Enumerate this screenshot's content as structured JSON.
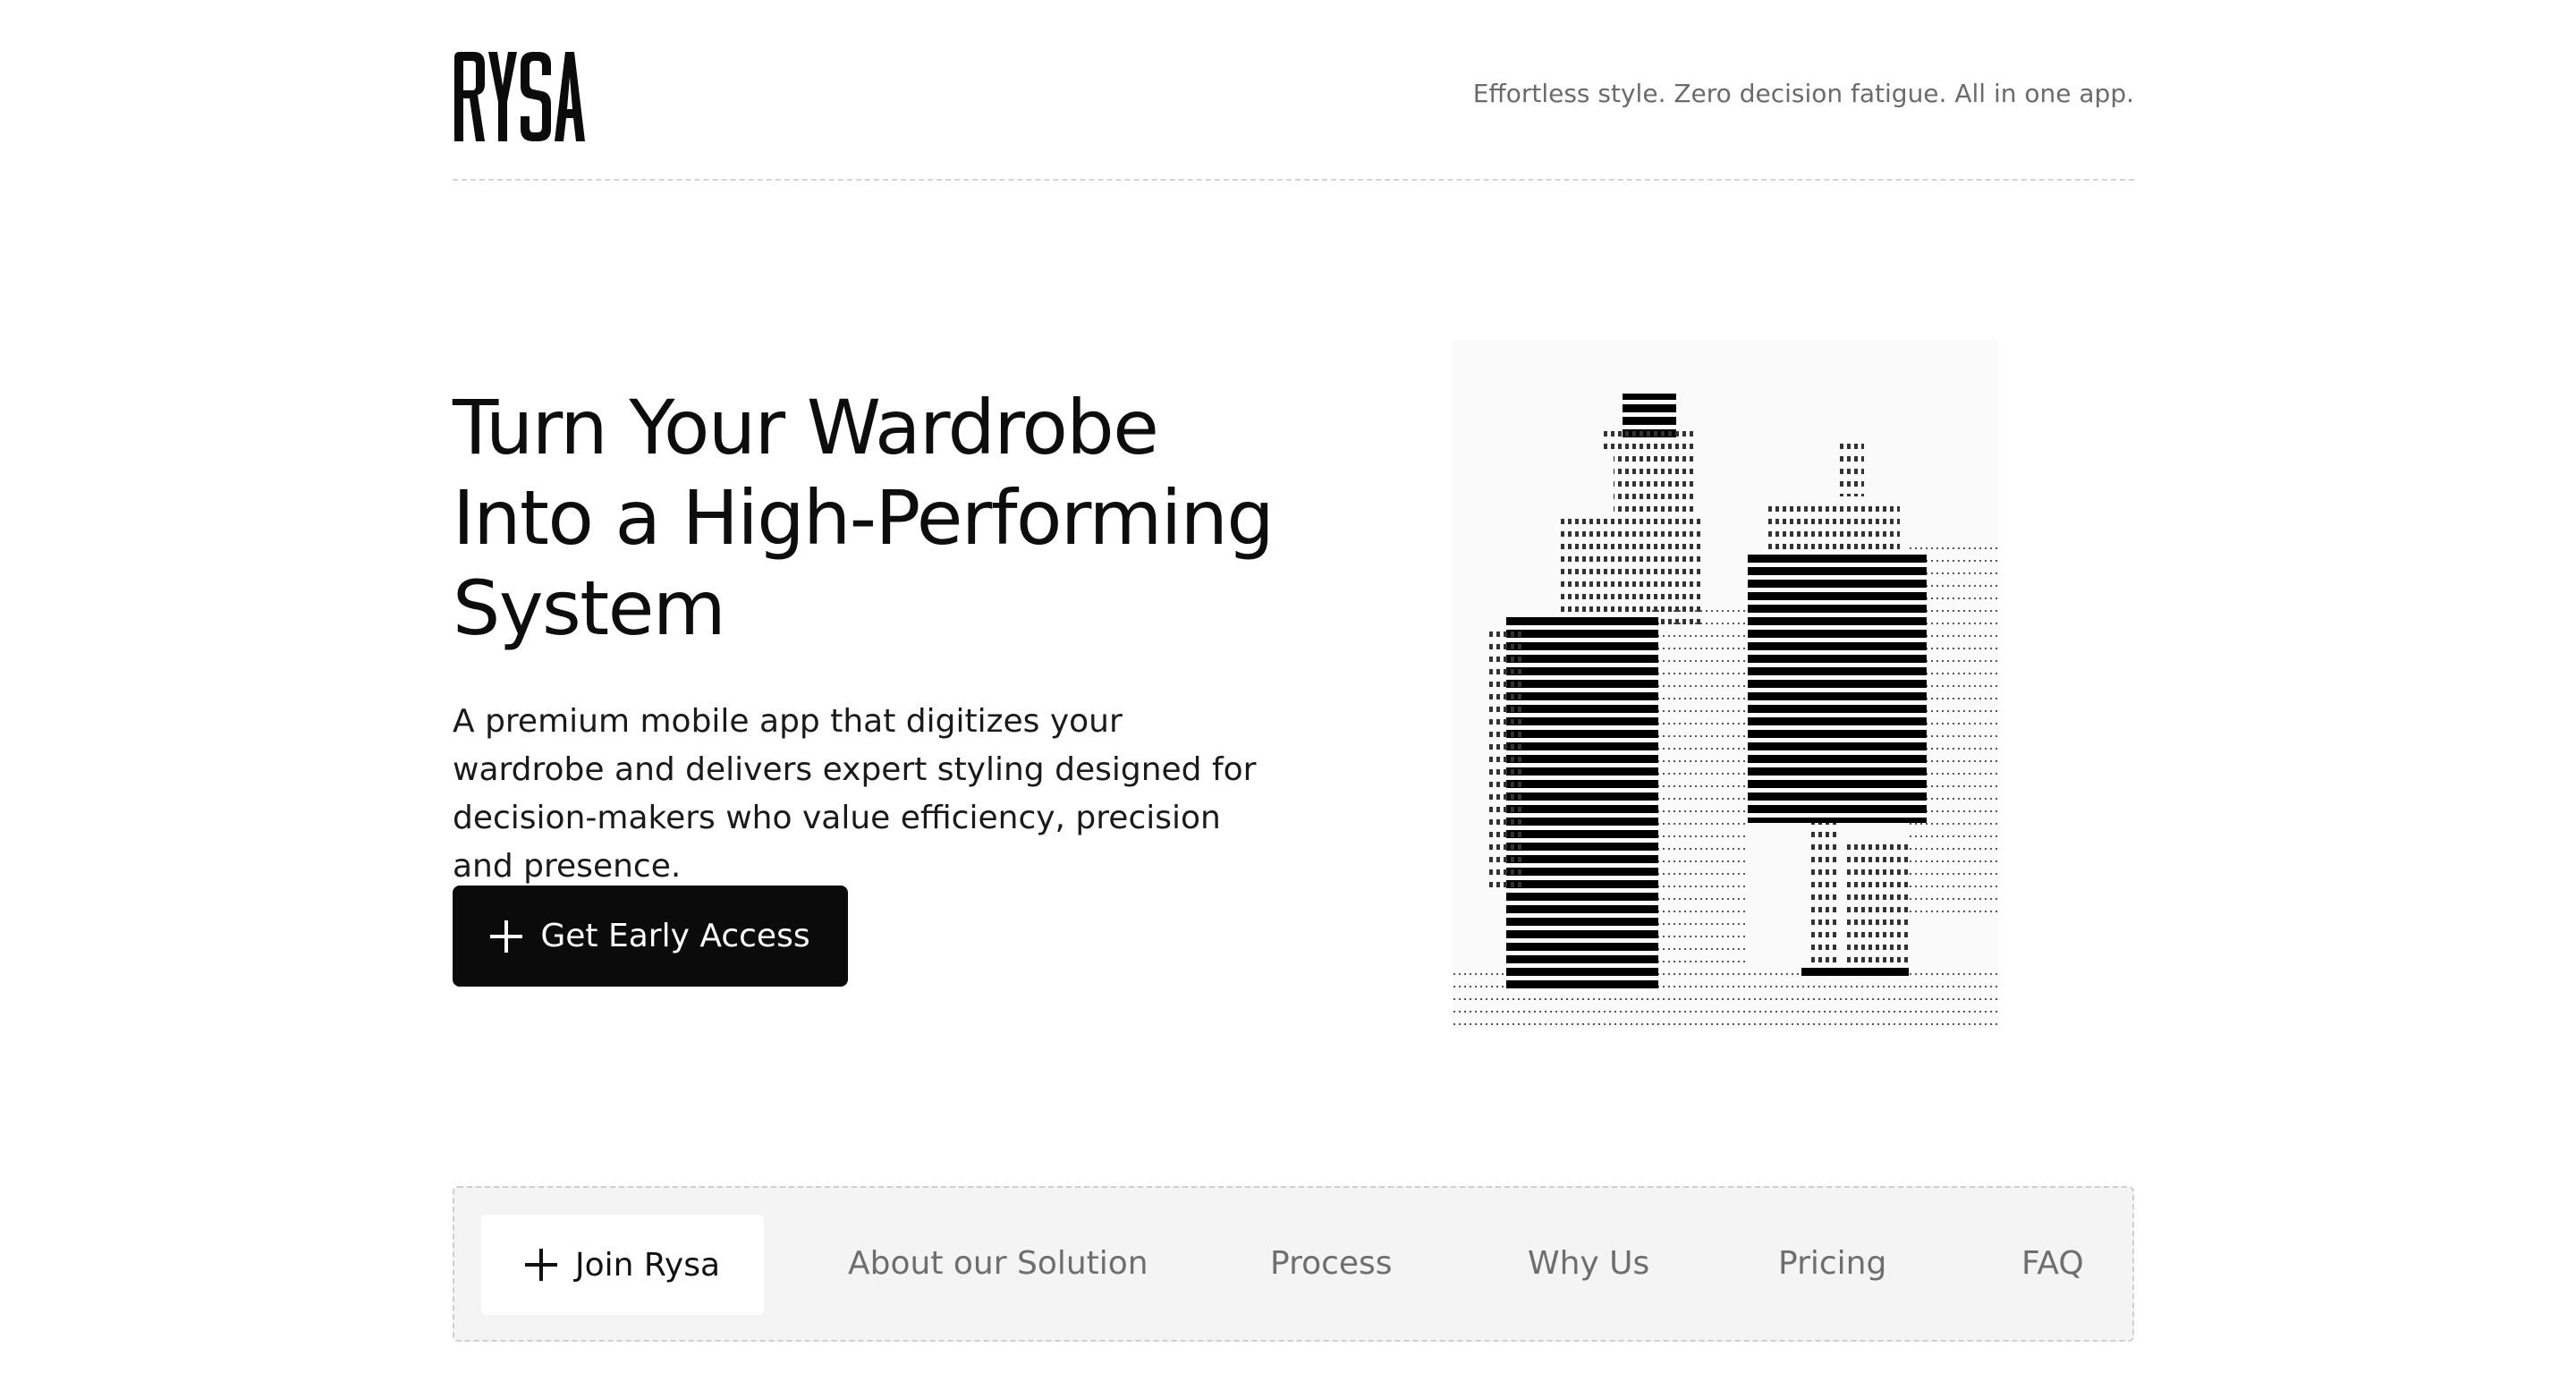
{
  "brand": {
    "name": "RYSA",
    "tagline": "Effortless style. Zero decision fatigue. All in one app."
  },
  "hero": {
    "title": "Turn Your Wardrobe Into a High-Performing System",
    "description": "A premium mobile app that digitizes your wardrobe and delivers expert styling designed for decision-makers who value efficiency, precision and presence.",
    "cta_label": "Get Early Access",
    "art_label": "rysa"
  },
  "nav": {
    "join_label": "Join Rysa",
    "items": [
      {
        "label": "About our Solution"
      },
      {
        "label": "Process"
      },
      {
        "label": "Why Us"
      },
      {
        "label": "Pricing"
      },
      {
        "label": "FAQ"
      }
    ]
  },
  "icons": {
    "cta_icon": "plus-icon",
    "join_icon": "plus-icon"
  },
  "colors": {
    "primary": "#0b0b0b",
    "nav_background": "#f4f4f4",
    "muted_text": "#6e6e6e"
  }
}
